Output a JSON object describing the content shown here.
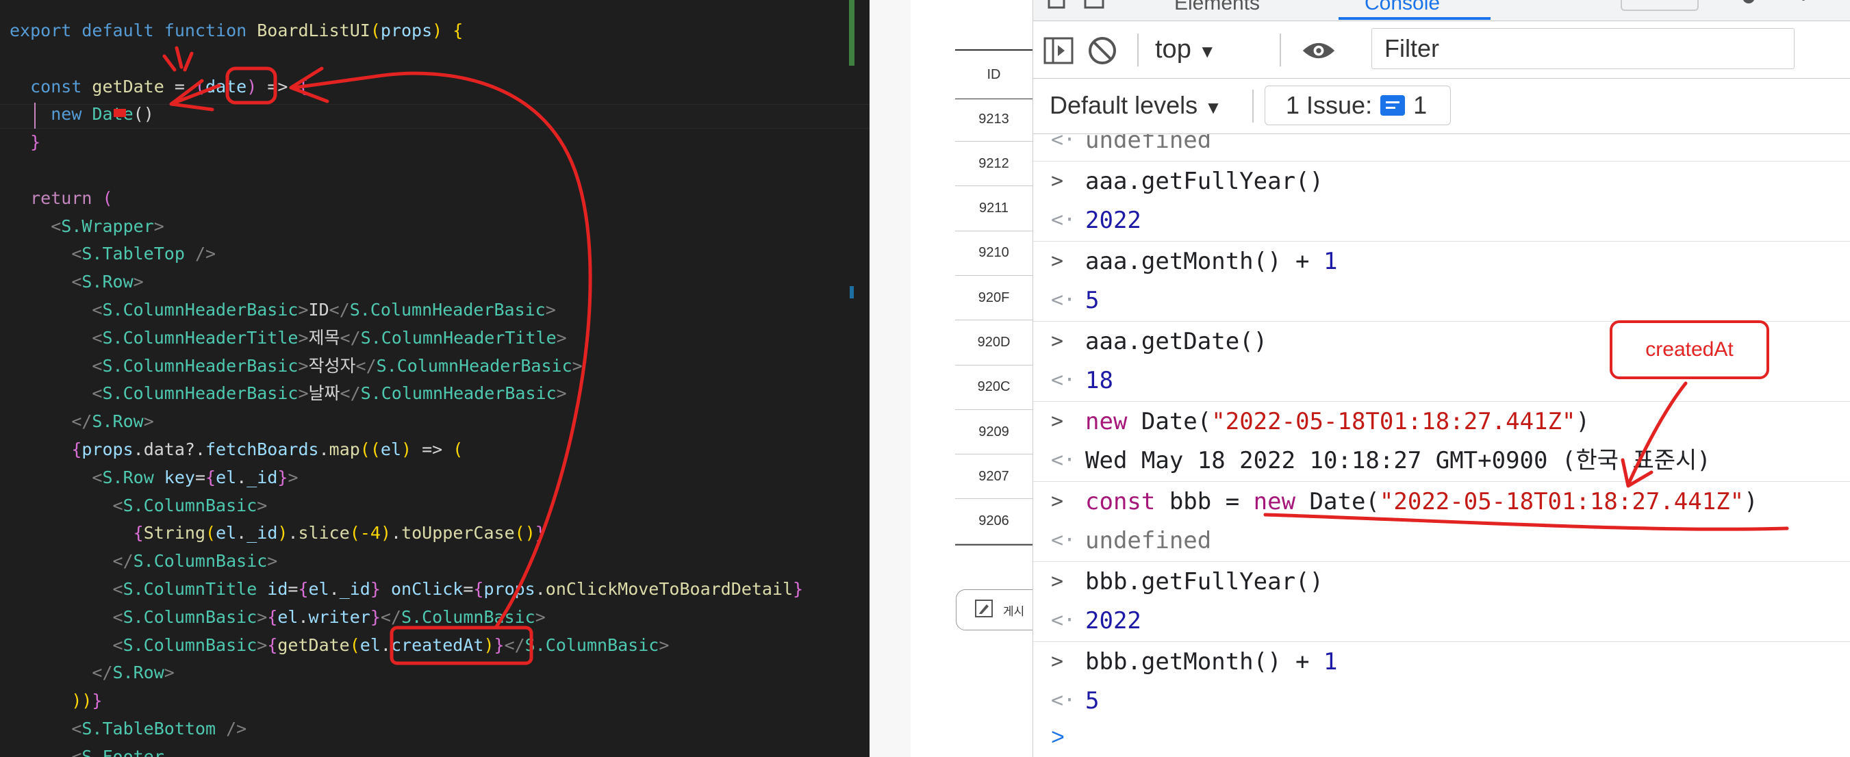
{
  "editor": {
    "lines": [
      [
        [
          "k",
          "export "
        ],
        [
          "k",
          "default "
        ],
        [
          "k",
          "function "
        ],
        [
          "f",
          "BoardListUI"
        ],
        [
          "b",
          "("
        ],
        [
          "v",
          "props"
        ],
        [
          "b",
          ") {"
        ]
      ],
      [],
      [
        [
          "",
          "  "
        ],
        [
          "k",
          "const "
        ],
        [
          "f",
          "getDate "
        ],
        [
          "",
          "= "
        ],
        [
          "m",
          "("
        ],
        [
          "v",
          "date"
        ],
        [
          "m",
          ")"
        ],
        [
          "",
          " => "
        ],
        [
          "m",
          "{"
        ]
      ],
      [
        [
          "",
          "    "
        ],
        [
          "k",
          "new "
        ],
        [
          "t",
          "Date"
        ],
        [
          "",
          "("
        ],
        [
          "",
          ")"
        ]
      ],
      [
        [
          "",
          "  "
        ],
        [
          "m",
          "}"
        ]
      ],
      [],
      [
        [
          "",
          "  "
        ],
        [
          "k2",
          "return "
        ],
        [
          "m",
          "("
        ]
      ],
      [
        [
          "",
          "    "
        ],
        [
          "p",
          "<"
        ],
        [
          "t",
          "S.Wrapper"
        ],
        [
          "p",
          ">"
        ]
      ],
      [
        [
          "",
          "      "
        ],
        [
          "p",
          "<"
        ],
        [
          "t",
          "S.TableTop "
        ],
        [
          "p",
          "/>"
        ]
      ],
      [
        [
          "",
          "      "
        ],
        [
          "p",
          "<"
        ],
        [
          "t",
          "S.Row"
        ],
        [
          "p",
          ">"
        ]
      ],
      [
        [
          "",
          "        "
        ],
        [
          "p",
          "<"
        ],
        [
          "t",
          "S.ColumnHeaderBasic"
        ],
        [
          "p",
          ">"
        ],
        [
          "",
          "ID"
        ],
        [
          "p",
          "</"
        ],
        [
          "t",
          "S.ColumnHeaderBasic"
        ],
        [
          "p",
          ">"
        ]
      ],
      [
        [
          "",
          "        "
        ],
        [
          "p",
          "<"
        ],
        [
          "t",
          "S.ColumnHeaderTitle"
        ],
        [
          "p",
          ">"
        ],
        [
          "",
          "제목"
        ],
        [
          "p",
          "</"
        ],
        [
          "t",
          "S.ColumnHeaderTitle"
        ],
        [
          "p",
          ">"
        ]
      ],
      [
        [
          "",
          "        "
        ],
        [
          "p",
          "<"
        ],
        [
          "t",
          "S.ColumnHeaderBasic"
        ],
        [
          "p",
          ">"
        ],
        [
          "",
          "작성자"
        ],
        [
          "p",
          "</"
        ],
        [
          "t",
          "S.ColumnHeaderBasic"
        ],
        [
          "p",
          ">"
        ]
      ],
      [
        [
          "",
          "        "
        ],
        [
          "p",
          "<"
        ],
        [
          "t",
          "S.ColumnHeaderBasic"
        ],
        [
          "p",
          ">"
        ],
        [
          "",
          "날짜"
        ],
        [
          "p",
          "</"
        ],
        [
          "t",
          "S.ColumnHeaderBasic"
        ],
        [
          "p",
          ">"
        ]
      ],
      [
        [
          "",
          "      "
        ],
        [
          "p",
          "</"
        ],
        [
          "t",
          "S.Row"
        ],
        [
          "p",
          ">"
        ]
      ],
      [
        [
          "",
          "      "
        ],
        [
          "m",
          "{"
        ],
        [
          "v",
          "props"
        ],
        [
          "",
          ".data?."
        ],
        [
          "v",
          "fetchBoards"
        ],
        [
          "",
          "."
        ],
        [
          "f",
          "map"
        ],
        [
          "b",
          "(("
        ],
        [
          "v",
          "el"
        ],
        [
          "b",
          ")"
        ],
        [
          "",
          " => "
        ],
        [
          "b",
          "("
        ]
      ],
      [
        [
          "",
          "        "
        ],
        [
          "p",
          "<"
        ],
        [
          "t",
          "S.Row "
        ],
        [
          "v",
          "key"
        ],
        [
          "",
          "="
        ],
        [
          "m",
          "{"
        ],
        [
          "v",
          "el"
        ],
        [
          "",
          "."
        ],
        [
          "v",
          "_id"
        ],
        [
          "m",
          "}"
        ],
        [
          "p",
          ">"
        ]
      ],
      [
        [
          "",
          "          "
        ],
        [
          "p",
          "<"
        ],
        [
          "t",
          "S.ColumnBasic"
        ],
        [
          "p",
          ">"
        ]
      ],
      [
        [
          "",
          "            "
        ],
        [
          "m",
          "{"
        ],
        [
          "f",
          "String"
        ],
        [
          "b",
          "("
        ],
        [
          "v",
          "el"
        ],
        [
          "",
          "."
        ],
        [
          "v",
          "_id"
        ],
        [
          "b",
          ")"
        ],
        [
          "",
          "."
        ],
        [
          "f",
          "slice"
        ],
        [
          "b",
          "("
        ],
        [
          "num",
          "-4"
        ],
        [
          "b",
          ")"
        ],
        [
          "",
          "."
        ],
        [
          "f",
          "toUpperCase"
        ],
        [
          "b",
          "()"
        ],
        [
          "m",
          "}"
        ]
      ],
      [
        [
          "",
          "          "
        ],
        [
          "p",
          "</"
        ],
        [
          "t",
          "S.ColumnBasic"
        ],
        [
          "p",
          ">"
        ]
      ],
      [
        [
          "",
          "          "
        ],
        [
          "p",
          "<"
        ],
        [
          "t",
          "S.ColumnTitle "
        ],
        [
          "v",
          "id"
        ],
        [
          "",
          "="
        ],
        [
          "m",
          "{"
        ],
        [
          "v",
          "el"
        ],
        [
          "",
          "."
        ],
        [
          "v",
          "_id"
        ],
        [
          "m",
          "}"
        ],
        [
          "",
          " "
        ],
        [
          "v",
          "onClick"
        ],
        [
          "",
          "="
        ],
        [
          "m",
          "{"
        ],
        [
          "v",
          "props"
        ],
        [
          "",
          "."
        ],
        [
          "f",
          "onClickMoveToBoardDetail"
        ],
        [
          "m",
          "}"
        ]
      ],
      [
        [
          "",
          "          "
        ],
        [
          "p",
          "<"
        ],
        [
          "t",
          "S.ColumnBasic"
        ],
        [
          "p",
          ">"
        ],
        [
          "m",
          "{"
        ],
        [
          "v",
          "el"
        ],
        [
          "",
          "."
        ],
        [
          "v",
          "writer"
        ],
        [
          "m",
          "}"
        ],
        [
          "p",
          "</"
        ],
        [
          "t",
          "S.ColumnBasic"
        ],
        [
          "p",
          ">"
        ]
      ],
      [
        [
          "",
          "          "
        ],
        [
          "p",
          "<"
        ],
        [
          "t",
          "S.ColumnBasic"
        ],
        [
          "p",
          ">"
        ],
        [
          "m",
          "{"
        ],
        [
          "f",
          "getDate"
        ],
        [
          "b",
          "("
        ],
        [
          "v",
          "el"
        ],
        [
          "",
          "."
        ],
        [
          "v",
          "createdAt"
        ],
        [
          "b",
          ")"
        ],
        [
          "m",
          "}"
        ],
        [
          "p",
          "</"
        ],
        [
          "t",
          "S.ColumnBasic"
        ],
        [
          "p",
          ">"
        ]
      ],
      [
        [
          "",
          "        "
        ],
        [
          "p",
          "</"
        ],
        [
          "t",
          "S.Row"
        ],
        [
          "p",
          ">"
        ]
      ],
      [
        [
          "",
          "      "
        ],
        [
          "b",
          "))"
        ],
        [
          "m",
          "}"
        ]
      ],
      [
        [
          "",
          "      "
        ],
        [
          "p",
          "<"
        ],
        [
          "t",
          "S.TableBottom "
        ],
        [
          "p",
          "/>"
        ]
      ],
      [
        [
          "",
          "      "
        ],
        [
          "p",
          "<"
        ],
        [
          "t",
          "S.Footer"
        ]
      ]
    ]
  },
  "board_table": {
    "header": "ID",
    "rows": [
      "9213",
      "9212",
      "9211",
      "9210",
      "920F",
      "920D",
      "920C",
      "9209",
      "9207",
      "9206"
    ],
    "write_button_label": "게시"
  },
  "devtools": {
    "tabs": [
      "Elements",
      "Console"
    ],
    "context": "top",
    "filter_placeholder": "Filter",
    "levels_label": "Default levels",
    "issue_label": "1 Issue:",
    "issue_count": "1",
    "console": [
      {
        "kind": "out",
        "parts": [
          [
            "undef",
            "undefined"
          ]
        ]
      },
      {
        "kind": "in",
        "parts": [
          [
            "",
            "aaa.getFullYear()"
          ]
        ]
      },
      {
        "kind": "out",
        "parts": [
          [
            "num",
            "2022"
          ]
        ]
      },
      {
        "kind": "in",
        "parts": [
          [
            "",
            "aaa.getMonth() + "
          ],
          [
            "num",
            "1"
          ]
        ]
      },
      {
        "kind": "out",
        "parts": [
          [
            "num",
            "5"
          ]
        ]
      },
      {
        "kind": "in",
        "parts": [
          [
            "",
            "aaa.getDate()"
          ]
        ]
      },
      {
        "kind": "out",
        "parts": [
          [
            "num",
            "18"
          ]
        ]
      },
      {
        "kind": "in",
        "parts": [
          [
            "kw",
            "new "
          ],
          [
            "",
            "Date("
          ],
          [
            "str",
            "\"2022-05-18T01:18:27.441Z\""
          ],
          [
            "",
            ")"
          ]
        ]
      },
      {
        "kind": "out",
        "parts": [
          [
            "",
            "Wed May 18 2022 10:18:27 GMT+0900 (한국 표준시)"
          ]
        ]
      },
      {
        "kind": "in",
        "parts": [
          [
            "kw",
            "const "
          ],
          [
            "",
            "bbb = "
          ],
          [
            "kw",
            "new "
          ],
          [
            "",
            "Date("
          ],
          [
            "str",
            "\"2022-05-18T01:18:27.441Z\""
          ],
          [
            "",
            ")"
          ]
        ]
      },
      {
        "kind": "out",
        "parts": [
          [
            "undef",
            "undefined"
          ]
        ]
      },
      {
        "kind": "in",
        "parts": [
          [
            "",
            "bbb.getFullYear()"
          ]
        ]
      },
      {
        "kind": "out",
        "parts": [
          [
            "num",
            "2022"
          ]
        ]
      },
      {
        "kind": "in",
        "parts": [
          [
            "",
            "bbb.getMonth() + "
          ],
          [
            "num",
            "1"
          ]
        ]
      },
      {
        "kind": "out",
        "parts": [
          [
            "num",
            "5"
          ]
        ]
      }
    ]
  },
  "annotation": {
    "note": "createdAt",
    "color": "#e32222"
  }
}
